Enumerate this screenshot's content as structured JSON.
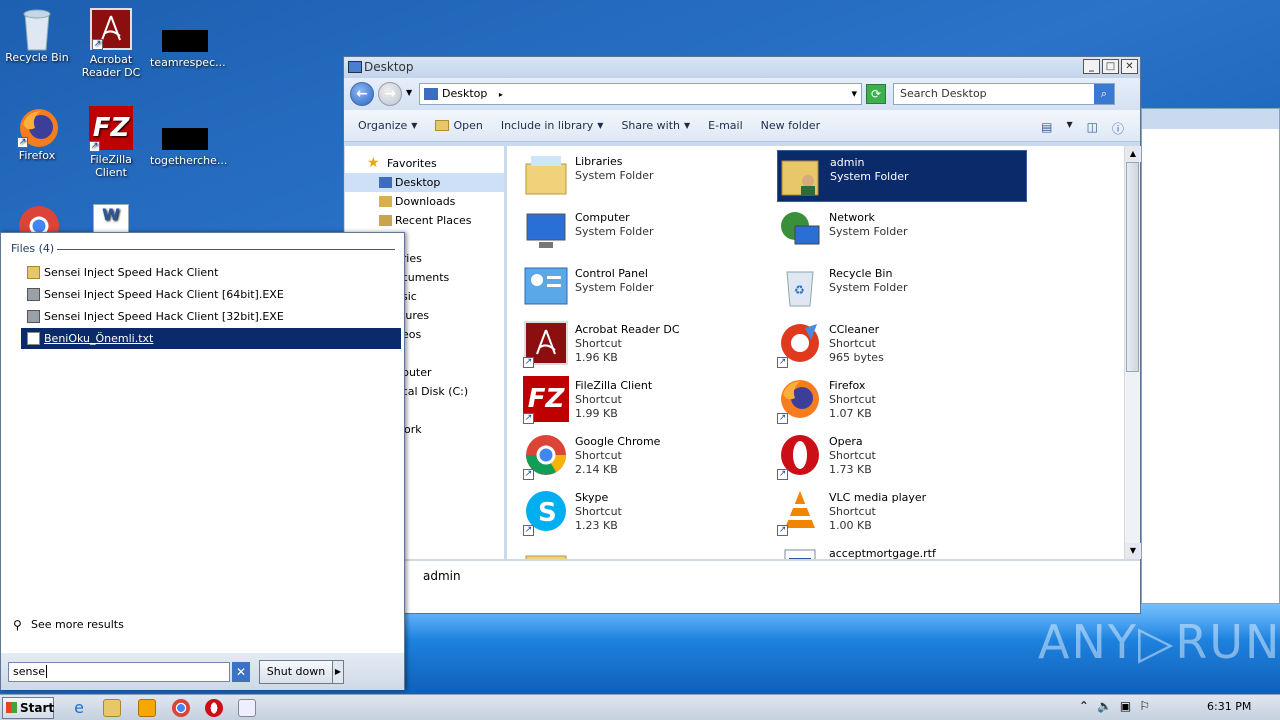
{
  "desktop": {
    "icons": [
      {
        "label": "Recycle Bin"
      },
      {
        "label": "Acrobat Reader DC"
      },
      {
        "label": "teamrespec..."
      },
      {
        "label": "Firefox"
      },
      {
        "label": "FileZilla Client"
      },
      {
        "label": "togetherche..."
      }
    ]
  },
  "explorer": {
    "title": "Desktop",
    "address": "Desktop",
    "search_placeholder": "Search Desktop",
    "toolbar": {
      "organize": "Organize",
      "open": "Open",
      "include": "Include in library",
      "share": "Share with",
      "email": "E-mail",
      "new_folder": "New folder"
    },
    "nav": {
      "favorites": "Favorites",
      "desktop": "Desktop",
      "downloads": "Downloads",
      "recent": "Recent Places",
      "libraries": "aries",
      "documents": "ocuments",
      "music": "usic",
      "pictures": "ctures",
      "videos": "deos",
      "computer": "nputer",
      "localdisk": "ocal Disk (C:)",
      "network": "work"
    },
    "items": [
      {
        "name": "Libraries",
        "line2": "System Folder",
        "line3": ""
      },
      {
        "name": "admin",
        "line2": "System Folder",
        "line3": ""
      },
      {
        "name": "Computer",
        "line2": "System Folder",
        "line3": ""
      },
      {
        "name": "Network",
        "line2": "System Folder",
        "line3": ""
      },
      {
        "name": "Control Panel",
        "line2": "System Folder",
        "line3": ""
      },
      {
        "name": "Recycle Bin",
        "line2": "System Folder",
        "line3": ""
      },
      {
        "name": "Acrobat Reader DC",
        "line2": "Shortcut",
        "line3": "1.96 KB"
      },
      {
        "name": "CCleaner",
        "line2": "Shortcut",
        "line3": "965 bytes"
      },
      {
        "name": "FileZilla Client",
        "line2": "Shortcut",
        "line3": "1.99 KB"
      },
      {
        "name": "Firefox",
        "line2": "Shortcut",
        "line3": "1.07 KB"
      },
      {
        "name": "Google Chrome",
        "line2": "Shortcut",
        "line3": "2.14 KB"
      },
      {
        "name": "Opera",
        "line2": "Shortcut",
        "line3": "1.73 KB"
      },
      {
        "name": "Skype",
        "line2": "Shortcut",
        "line3": "1.23 KB"
      },
      {
        "name": "VLC media player",
        "line2": "Shortcut",
        "line3": "1.00 KB"
      },
      {
        "name": "acceptmortgage.rtf",
        "line2": "",
        "line3": ""
      }
    ],
    "details_text": "admin"
  },
  "start_menu": {
    "header": "Files (4)",
    "results": [
      {
        "label": "Sensei Inject Speed Hack Client"
      },
      {
        "label": "Sensei Inject Speed Hack Client [64bit].EXE"
      },
      {
        "label": "Sensei Inject Speed Hack Client [32bit].EXE"
      },
      {
        "label": "BeniOku_Önemli.txt"
      }
    ],
    "see_more": "See more results",
    "search_value": "sense",
    "shutdown": "Shut down"
  },
  "taskbar": {
    "start": "Start",
    "clock": "6:31 PM"
  },
  "watermark": "ANY▷RUN",
  "colors": {
    "selection": "#0a2a6a",
    "desktop_bg": "#1d5fb0"
  }
}
